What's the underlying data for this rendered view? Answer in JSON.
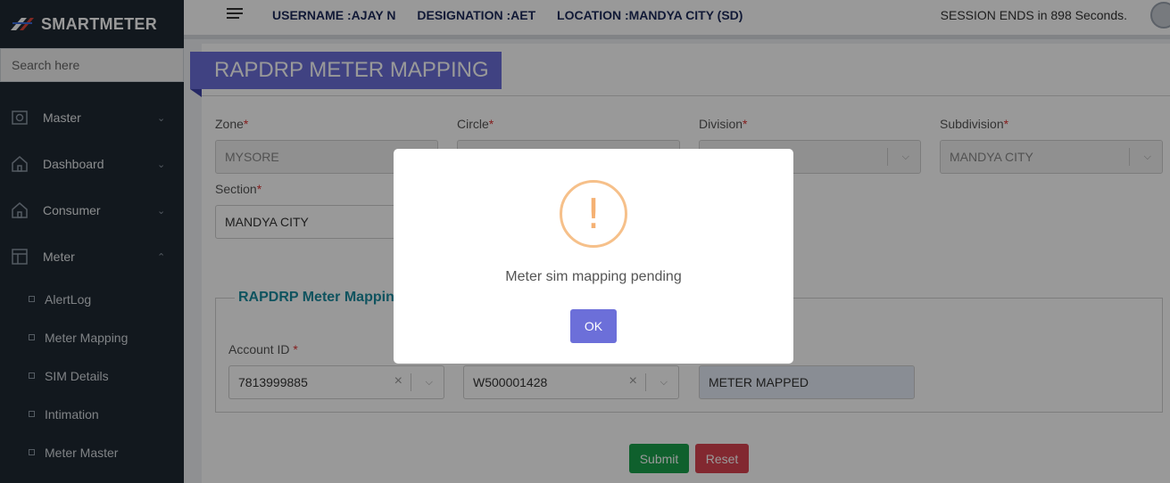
{
  "brand": {
    "name": "SMARTMETER"
  },
  "search": {
    "placeholder": "Search here"
  },
  "nav": [
    {
      "label": "Master",
      "icon": "camera-icon",
      "chevron": "chevron-down-icon"
    },
    {
      "label": "Dashboard",
      "icon": "home-icon",
      "chevron": "chevron-down-icon"
    },
    {
      "label": "Consumer",
      "icon": "home-icon",
      "chevron": "chevron-down-icon"
    },
    {
      "label": "Meter",
      "icon": "layout-icon",
      "chevron": "chevron-up-icon"
    }
  ],
  "submenu": [
    "AlertLog",
    "Meter Mapping",
    "SIM Details",
    "Intimation",
    "Meter Master"
  ],
  "topbar": {
    "username": "USERNAME :AJAY N",
    "designation": "DESIGNATION :AET",
    "location": "LOCATION :MANDYA CITY (SD)",
    "session": "SESSION ENDS in 898 Seconds."
  },
  "page": {
    "title": "RAPDRP METER MAPPING"
  },
  "filters": {
    "zone": {
      "label": "Zone",
      "value": "MYSORE"
    },
    "circle": {
      "label": "Circle",
      "value": ""
    },
    "division": {
      "label": "Division",
      "value": ""
    },
    "subdivision": {
      "label": "Subdivision",
      "value": "MANDYA CITY"
    },
    "section": {
      "label": "Section",
      "value": "MANDYA CITY"
    }
  },
  "mapping": {
    "legend": "RAPDRP Meter Mapping",
    "account_label": "Account ID",
    "account_value": "7813999885",
    "meter_value": "W500001428",
    "status_value": "METER MAPPED"
  },
  "buttons": {
    "submit": "Submit",
    "reset": "Reset"
  },
  "required_mark": "*",
  "modal": {
    "icon": "!",
    "message": "Meter sim mapping pending",
    "ok": "OK"
  },
  "colors": {
    "accent": "#6c6fd9",
    "sidebar": "#1f2832",
    "submit": "#1aa14b",
    "reset": "#d94451",
    "warning": "#f5b173"
  }
}
